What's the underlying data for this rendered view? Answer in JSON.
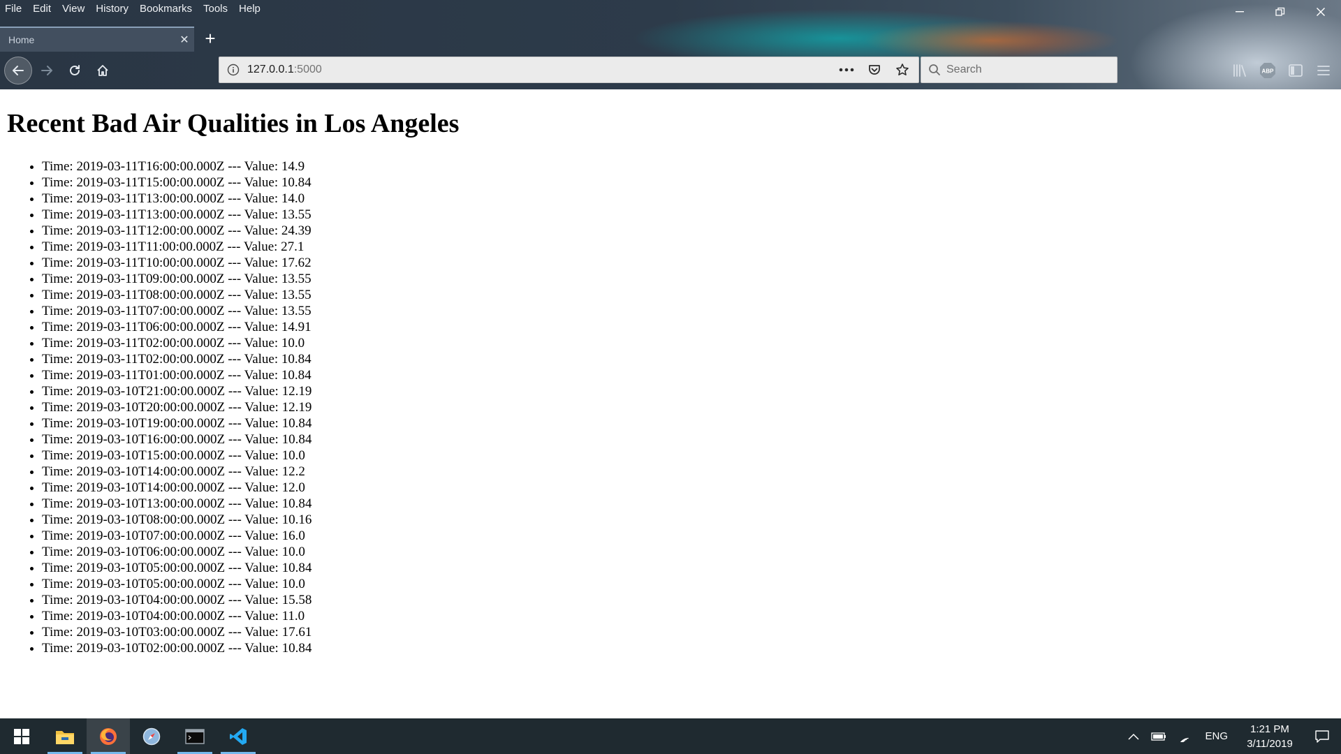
{
  "browser": {
    "menu": [
      "File",
      "Edit",
      "View",
      "History",
      "Bookmarks",
      "Tools",
      "Help"
    ],
    "tab": {
      "title": "Home",
      "close": "✕"
    },
    "new_tab": "+",
    "url": {
      "host": "127.0.0.1",
      "port": ":5000"
    },
    "search_placeholder": "Search",
    "window_controls": {
      "restore": "❐",
      "close": "✕"
    }
  },
  "page": {
    "title": "Recent Bad Air Qualities in Los Angeles",
    "readings": [
      {
        "time": "2019-03-11T16:00:00.000Z",
        "value": "14.9"
      },
      {
        "time": "2019-03-11T15:00:00.000Z",
        "value": "10.84"
      },
      {
        "time": "2019-03-11T13:00:00.000Z",
        "value": "14.0"
      },
      {
        "time": "2019-03-11T13:00:00.000Z",
        "value": "13.55"
      },
      {
        "time": "2019-03-11T12:00:00.000Z",
        "value": "24.39"
      },
      {
        "time": "2019-03-11T11:00:00.000Z",
        "value": "27.1"
      },
      {
        "time": "2019-03-11T10:00:00.000Z",
        "value": "17.62"
      },
      {
        "time": "2019-03-11T09:00:00.000Z",
        "value": "13.55"
      },
      {
        "time": "2019-03-11T08:00:00.000Z",
        "value": "13.55"
      },
      {
        "time": "2019-03-11T07:00:00.000Z",
        "value": "13.55"
      },
      {
        "time": "2019-03-11T06:00:00.000Z",
        "value": "14.91"
      },
      {
        "time": "2019-03-11T02:00:00.000Z",
        "value": "10.0"
      },
      {
        "time": "2019-03-11T02:00:00.000Z",
        "value": "10.84"
      },
      {
        "time": "2019-03-11T01:00:00.000Z",
        "value": "10.84"
      },
      {
        "time": "2019-03-10T21:00:00.000Z",
        "value": "12.19"
      },
      {
        "time": "2019-03-10T20:00:00.000Z",
        "value": "12.19"
      },
      {
        "time": "2019-03-10T19:00:00.000Z",
        "value": "10.84"
      },
      {
        "time": "2019-03-10T16:00:00.000Z",
        "value": "10.84"
      },
      {
        "time": "2019-03-10T15:00:00.000Z",
        "value": "10.0"
      },
      {
        "time": "2019-03-10T14:00:00.000Z",
        "value": "12.2"
      },
      {
        "time": "2019-03-10T14:00:00.000Z",
        "value": "12.0"
      },
      {
        "time": "2019-03-10T13:00:00.000Z",
        "value": "10.84"
      },
      {
        "time": "2019-03-10T08:00:00.000Z",
        "value": "10.16"
      },
      {
        "time": "2019-03-10T07:00:00.000Z",
        "value": "16.0"
      },
      {
        "time": "2019-03-10T06:00:00.000Z",
        "value": "10.0"
      },
      {
        "time": "2019-03-10T05:00:00.000Z",
        "value": "10.84"
      },
      {
        "time": "2019-03-10T05:00:00.000Z",
        "value": "10.0"
      },
      {
        "time": "2019-03-10T04:00:00.000Z",
        "value": "15.58"
      },
      {
        "time": "2019-03-10T04:00:00.000Z",
        "value": "11.0"
      },
      {
        "time": "2019-03-10T03:00:00.000Z",
        "value": "17.61"
      },
      {
        "time": "2019-03-10T02:00:00.000Z",
        "value": "10.84"
      }
    ],
    "labels": {
      "time": "Time: ",
      "separator": " --- ",
      "value": "Value: "
    }
  },
  "taskbar": {
    "apps": [
      "windows-start-icon",
      "file-explorer-icon",
      "firefox-icon",
      "safari-compass-icon",
      "terminal-icon",
      "vscode-icon"
    ],
    "tray": {
      "lang": "ENG",
      "time": "1:21 PM",
      "date": "3/11/2019"
    }
  },
  "colors": {
    "taskbar_bg": "#1f2a30",
    "accent": "#76b9ed",
    "firefox_orange": "#ff7139",
    "vscode_blue": "#23a9f2"
  }
}
